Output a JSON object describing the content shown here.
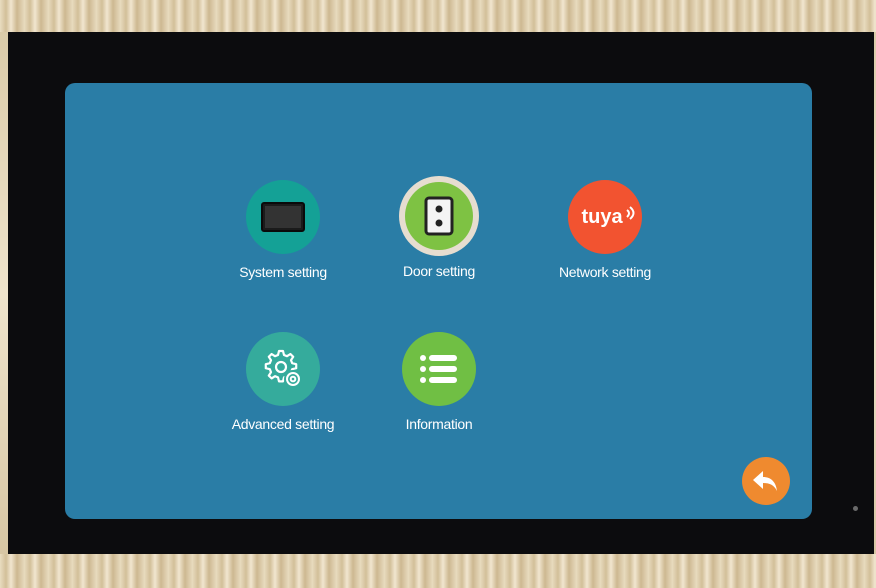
{
  "menu": {
    "items": [
      {
        "id": "system",
        "label": "System setting",
        "icon": "monitor-icon",
        "color": "#14a196"
      },
      {
        "id": "door",
        "label": "Door setting",
        "icon": "door-station-icon",
        "color": "#7ec243"
      },
      {
        "id": "network",
        "label": "Network setting",
        "icon": "tuya-logo-icon",
        "color": "#f25330",
        "logo_text": "tuya"
      },
      {
        "id": "advanced",
        "label": "Advanced setting",
        "icon": "gears-icon",
        "color": "#35ab9c"
      },
      {
        "id": "information",
        "label": "Information",
        "icon": "list-icon",
        "color": "#70bf44"
      }
    ]
  },
  "back": {
    "icon": "back-arrow-icon",
    "color": "#ef8a2f"
  },
  "colors": {
    "screen": "#2a7da6",
    "bezel": "#0c0c0e",
    "frame": "#e3d4b4"
  }
}
